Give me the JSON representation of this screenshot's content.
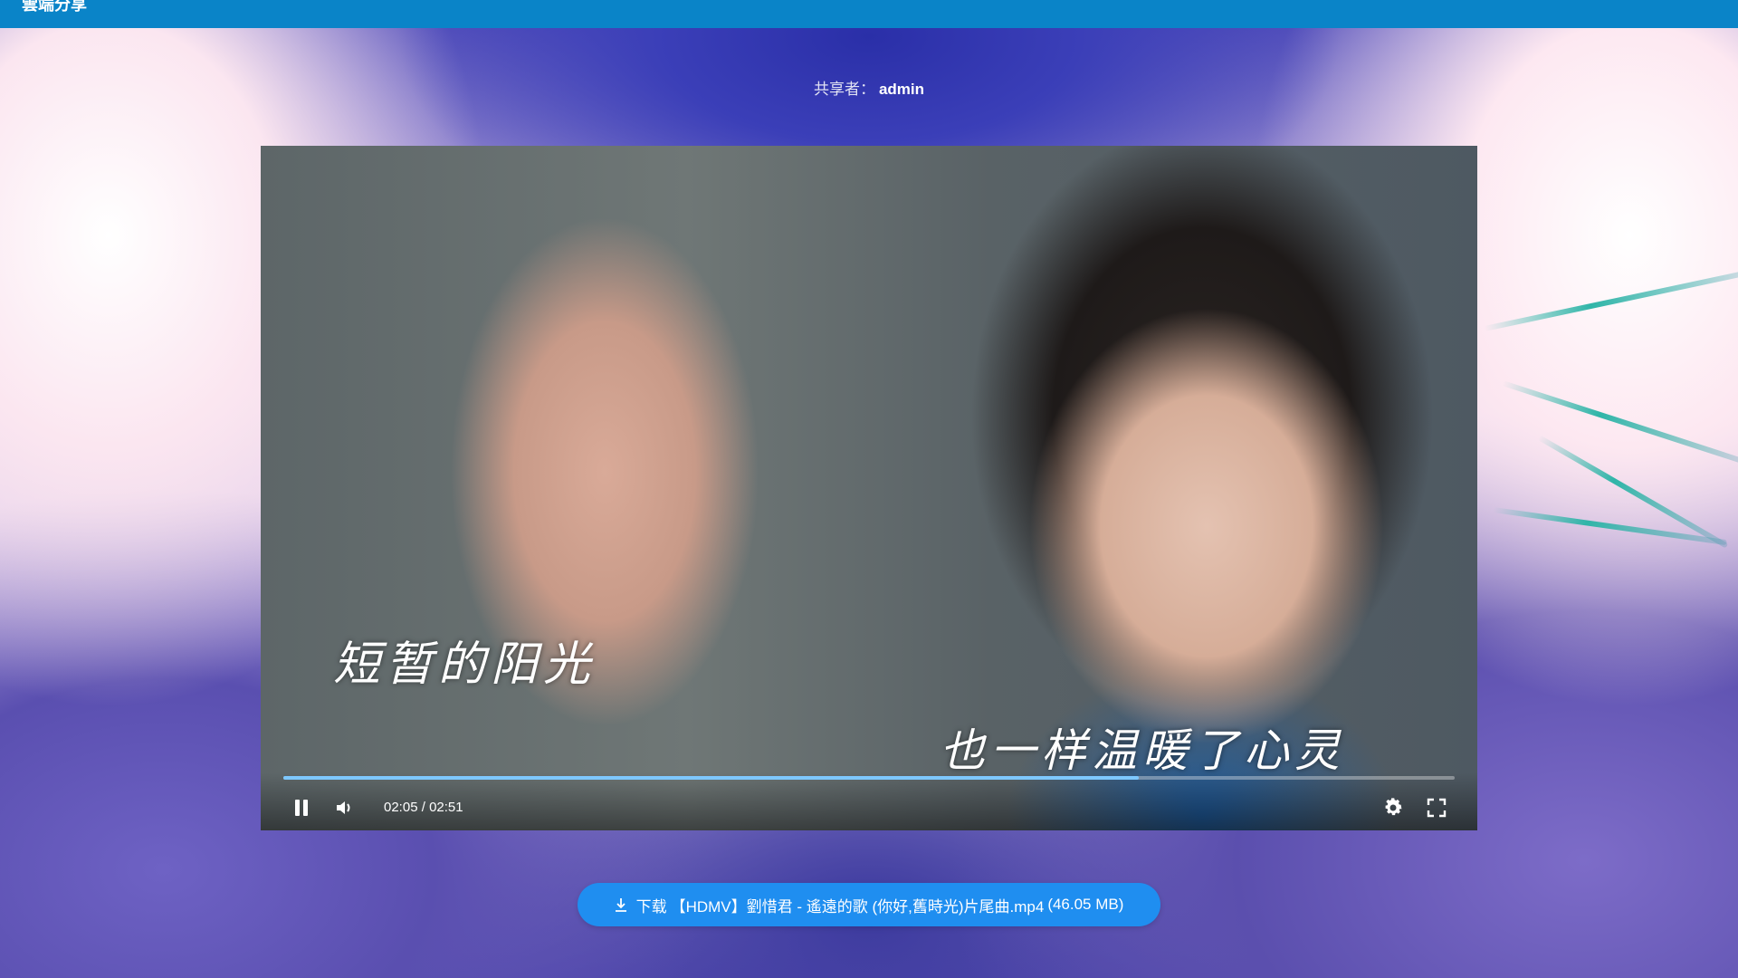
{
  "header": {
    "brand": "雲端分享"
  },
  "share": {
    "label": "共享者：",
    "user": "admin"
  },
  "player": {
    "subtitles": [
      "短暂的阳光",
      "也一样温暖了心灵"
    ],
    "current_time": "02:05",
    "separator": "/",
    "duration": "02:51",
    "progress": 0.73,
    "state": "playing",
    "icons": {
      "play_pause": "pause-icon",
      "volume": "volume-icon",
      "settings": "gear-icon",
      "fullscreen": "fullscreen-icon"
    }
  },
  "download": {
    "label": "下载",
    "filename": "【HDMV】劉惜君 - 遙遠的歌 (你好,舊時光)片尾曲.mp4",
    "size": "(46.05 MB)",
    "icon": "download-icon"
  },
  "colors": {
    "topbar": "#0a84c8",
    "download_button": "#1f8ef0",
    "progress_fill": "#7ec8ff"
  }
}
